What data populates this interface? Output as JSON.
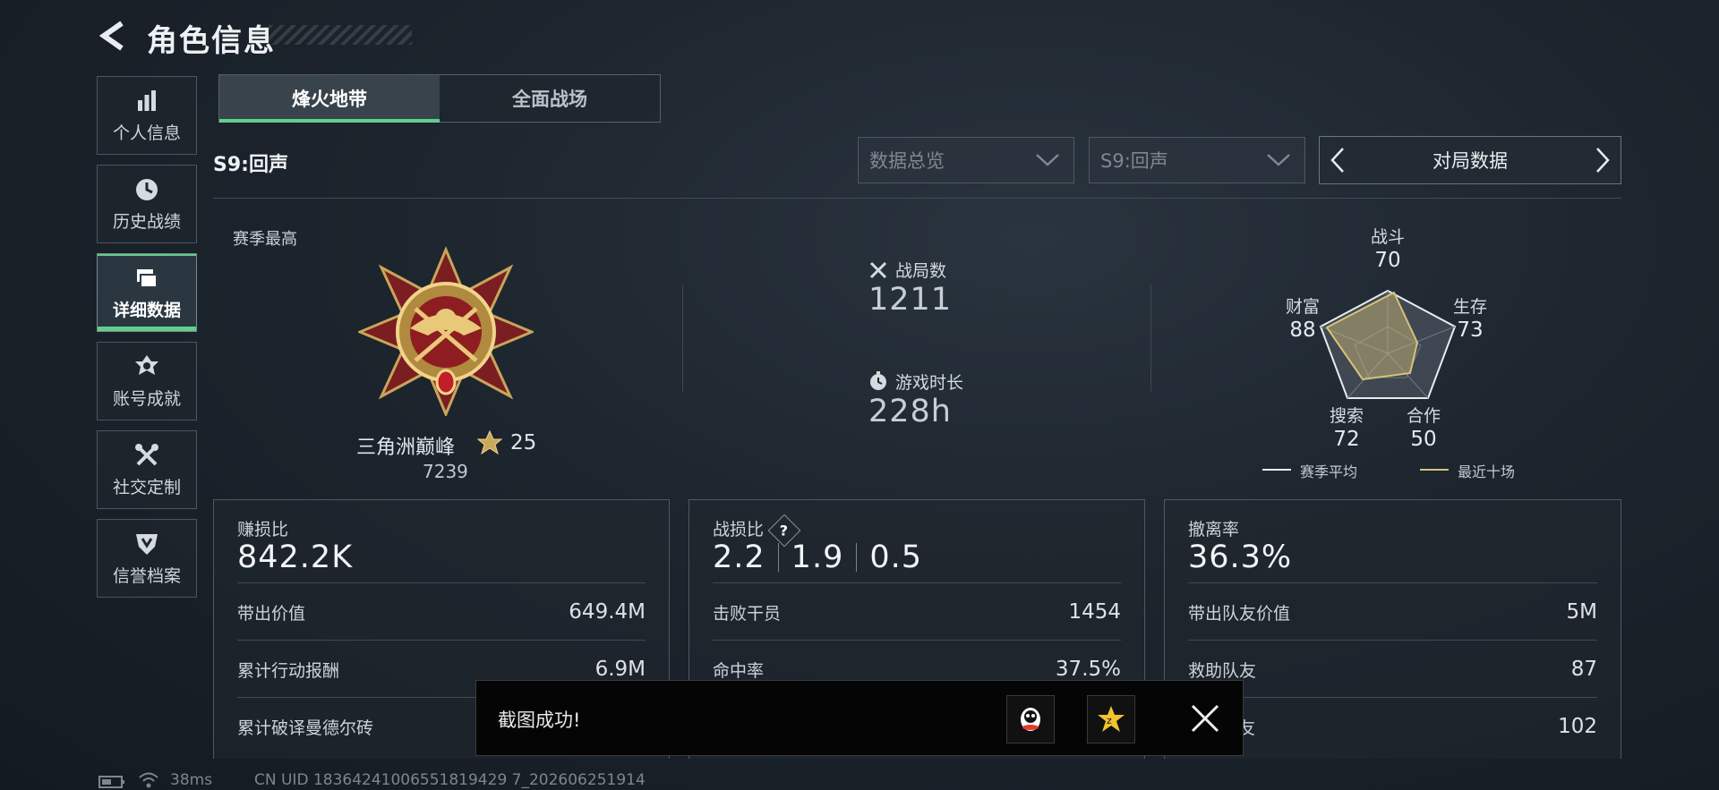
{
  "header": {
    "title": "角色信息"
  },
  "sidebar": {
    "items": [
      {
        "label": "个人信息",
        "icon": "bar-chart-icon"
      },
      {
        "label": "历史战绩",
        "icon": "clock-icon"
      },
      {
        "label": "详细数据",
        "icon": "folder-icon",
        "active": true
      },
      {
        "label": "账号成就",
        "icon": "medal-icon"
      },
      {
        "label": "社交定制",
        "icon": "tools-icon"
      },
      {
        "label": "信誉档案",
        "icon": "shield-icon"
      }
    ]
  },
  "mode_tabs": [
    {
      "label": "烽火地带",
      "active": true
    },
    {
      "label": "全面战场",
      "active": false
    }
  ],
  "season_label": "S9:回声",
  "filters": {
    "view_select": "数据总览",
    "season_select": "S9:回声",
    "pager_label": "对局数据"
  },
  "best": {
    "label": "赛季最高",
    "rank_name": "三角洲巅峰",
    "rank_stars": "25",
    "rank_score": "7239"
  },
  "stats": {
    "matches_label": "战局数",
    "matches_value": "1211",
    "playtime_label": "游戏时长",
    "playtime_value": "228h"
  },
  "radar": {
    "axes": [
      {
        "label": "战斗",
        "value": "70"
      },
      {
        "label": "生存",
        "value": "73"
      },
      {
        "label": "合作",
        "value": "50"
      },
      {
        "label": "搜索",
        "value": "72"
      },
      {
        "label": "财富",
        "value": "88"
      }
    ],
    "legend": {
      "season_avg": "赛季平均",
      "recent_ten": "最近十场"
    },
    "colors": {
      "season_avg": "#e8ecef",
      "recent_ten": "#d7c27a"
    }
  },
  "cards": {
    "profit": {
      "label": "赚损比",
      "value": "842.2K",
      "rows": [
        {
          "label": "带出价值",
          "value": "649.4M"
        },
        {
          "label": "累计行动报酬",
          "value": "6.9M"
        },
        {
          "label": "累计破译曼德尔砖",
          "value": ""
        }
      ]
    },
    "kd": {
      "label": "战损比",
      "values": [
        "2.2",
        "1.9",
        "0.5"
      ],
      "rows": [
        {
          "label": "击败干员",
          "value": "1454"
        },
        {
          "label": "命中率",
          "value": "37.5%"
        }
      ]
    },
    "extract": {
      "label": "撤离率",
      "value": "36.3%",
      "rows": [
        {
          "label": "带出队友价值",
          "value": "5M"
        },
        {
          "label": "救助队友",
          "value": "87"
        },
        {
          "label": "友",
          "value": "102"
        }
      ]
    }
  },
  "toast": {
    "message": "截图成功!"
  },
  "footer": {
    "ping": "38ms",
    "uid": "CN UID 18364241006551819429 7_202606251914"
  },
  "colors": {
    "accent": "#5fd08c",
    "background": "#1c242d"
  }
}
